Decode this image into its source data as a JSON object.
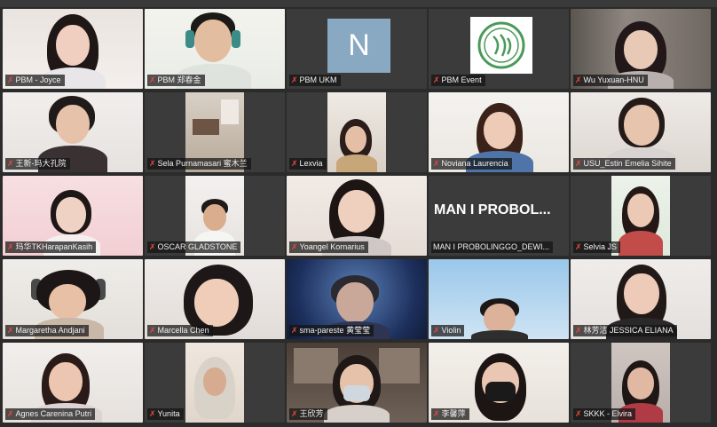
{
  "participants": [
    {
      "name": "PBM - Joyce",
      "mic": "muted"
    },
    {
      "name": "PBM 郑春金",
      "mic": "muted"
    },
    {
      "name": "PBM UKM",
      "mic": "muted",
      "avatar_letter": "N"
    },
    {
      "name": "PBM Event",
      "mic": "muted"
    },
    {
      "name": "Wu Yuxuan-HNU",
      "mic": "muted"
    },
    {
      "name": "王新-玛大孔院",
      "mic": "muted"
    },
    {
      "name": "Sela Purnamasari 蜜木兰",
      "mic": "muted"
    },
    {
      "name": "Lexvia",
      "mic": "muted"
    },
    {
      "name": "Noviana Laurencia",
      "mic": "muted"
    },
    {
      "name": "USU_Estin Emelia Sihite",
      "mic": "muted"
    },
    {
      "name": "玛华TKHarapanKasih",
      "mic": "muted"
    },
    {
      "name": "OSCAR GLADSTONE",
      "mic": "muted"
    },
    {
      "name": "Yoangel Kornarius",
      "mic": "muted"
    },
    {
      "name": "MAN I PROBOLINGGO_DEWI...",
      "mic": "muted",
      "display_title": "MAN I PROBOL..."
    },
    {
      "name": "Selvia JS",
      "mic": "muted"
    },
    {
      "name": "Margaretha Andjani",
      "mic": "muted"
    },
    {
      "name": "Marcella Chen",
      "mic": "muted"
    },
    {
      "name": "sma-pareste 黄莹莹",
      "mic": "muted"
    },
    {
      "name": "Violin",
      "mic": "muted"
    },
    {
      "name": "林芳洁 JESSICA ELIANA",
      "mic": "muted"
    },
    {
      "name": "Agnes Carenina Putri",
      "mic": "muted"
    },
    {
      "name": "Yunita",
      "mic": "muted"
    },
    {
      "name": "王欣芳",
      "mic": "muted"
    },
    {
      "name": "李馨萍",
      "mic": "muted"
    },
    {
      "name": "SKKK - Elvira",
      "mic": "muted"
    }
  ],
  "icons": {
    "muted_mic": "mic-muted-icon"
  },
  "colors": {
    "active_speaker_border": "#c9d34a",
    "muted_mic": "#e5483f",
    "name_label_bg": "#141414"
  }
}
